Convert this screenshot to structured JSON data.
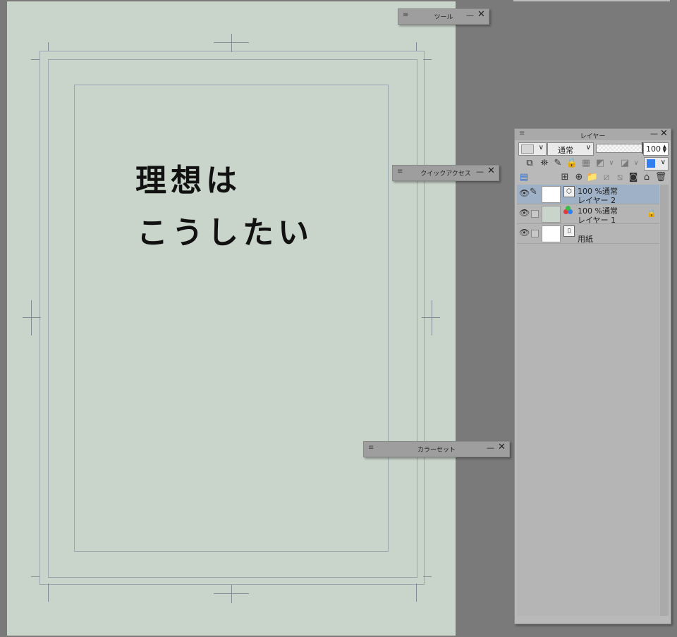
{
  "canvas": {
    "text_line1": "理想は",
    "text_line2": "こうしたい"
  },
  "panels": {
    "tool": {
      "title": "ツール"
    },
    "quick_access": {
      "title": "クイックアクセス"
    },
    "color_set": {
      "title": "カラーセット"
    }
  },
  "layer_panel": {
    "title": "レイヤー",
    "blend_mode": "通常",
    "opacity": "100",
    "opacity_fraction": 1.0,
    "draw_color": "#2f7ff2",
    "layers": [
      {
        "mode": "100 %通常",
        "name": "レイヤー 2",
        "selected": true
      },
      {
        "mode": "100 %通常",
        "name": "レイヤー 1",
        "locked": true
      },
      {
        "mode": "",
        "name": "用紙"
      }
    ]
  },
  "icons": {
    "menu": "≡",
    "minimize": "—",
    "close": "✕",
    "eye": "👁",
    "pencil": "✎",
    "lock": "🔒",
    "dropdown": "∨",
    "trash": "🗑"
  }
}
